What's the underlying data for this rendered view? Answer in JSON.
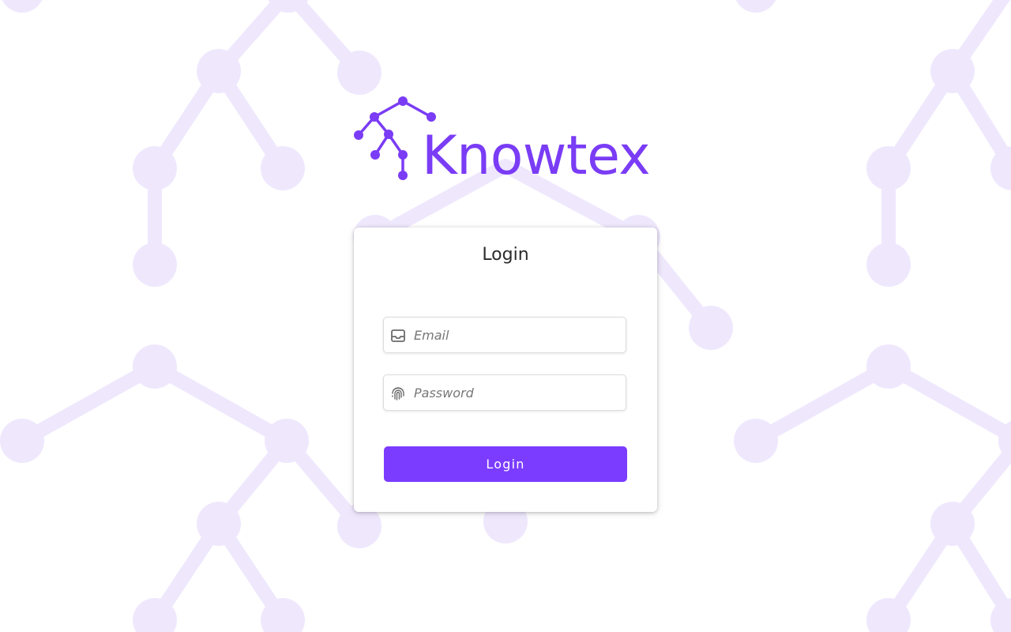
{
  "brand": {
    "name": "Knowtex",
    "logo_icon": "tree-network-icon",
    "color": "#7a3cf5"
  },
  "background": {
    "pattern_icon": "tree-network-pattern",
    "color": "#efe8fd"
  },
  "login_card": {
    "title": "Login",
    "email": {
      "icon": "inbox-icon",
      "placeholder": "Email",
      "value": ""
    },
    "password": {
      "icon": "fingerprint-icon",
      "placeholder": "Password",
      "value": ""
    },
    "submit_label": "Login",
    "submit_color": "#7b3cff"
  }
}
